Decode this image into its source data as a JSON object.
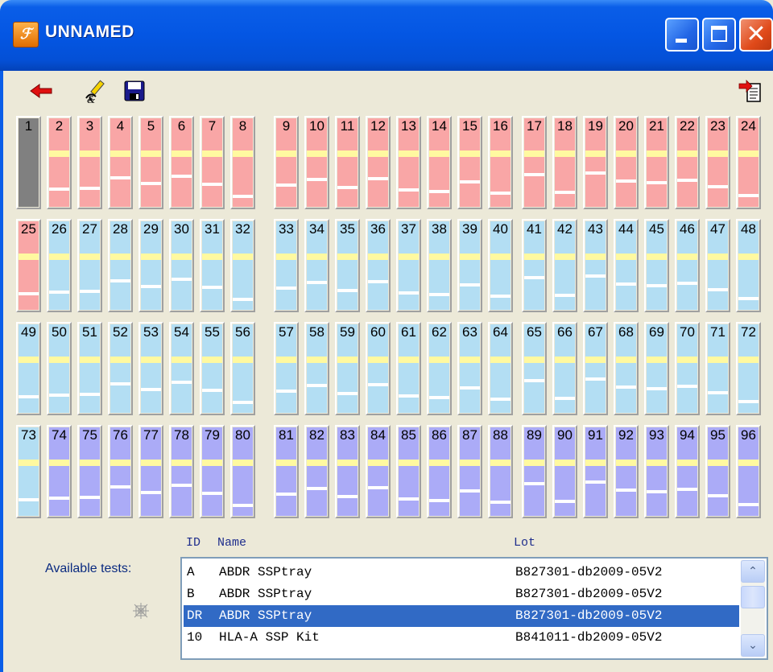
{
  "window": {
    "title": "UNNAMED",
    "accent": "#0a5ee8"
  },
  "toolbar": {
    "back_icon": "red-left-arrow-icon",
    "clear_icon": "eraser-pencil-icon",
    "save_icon": "floppy-disk-icon",
    "export_icon": "export-document-icon"
  },
  "colors": {
    "pink": "#f9a6a6",
    "blue": "#b3def3",
    "purple": "#ababf7",
    "selected_well": "#808080",
    "highlight": "#fff9a0"
  },
  "wells": [
    {
      "label": "1",
      "color": "#808080",
      "selected": true
    },
    {
      "label": "2",
      "color": "#f9a6a6"
    },
    {
      "label": "3",
      "color": "#f9a6a6"
    },
    {
      "label": "4",
      "color": "#f9a6a6"
    },
    {
      "label": "5",
      "color": "#f9a6a6"
    },
    {
      "label": "6",
      "color": "#f9a6a6"
    },
    {
      "label": "7",
      "color": "#f9a6a6"
    },
    {
      "label": "8",
      "color": "#f9a6a6"
    },
    {
      "label": "9",
      "color": "#f9a6a6"
    },
    {
      "label": "10",
      "color": "#f9a6a6"
    },
    {
      "label": "11",
      "color": "#f9a6a6"
    },
    {
      "label": "12",
      "color": "#f9a6a6"
    },
    {
      "label": "13",
      "color": "#f9a6a6"
    },
    {
      "label": "14",
      "color": "#f9a6a6"
    },
    {
      "label": "15",
      "color": "#f9a6a6"
    },
    {
      "label": "16",
      "color": "#f9a6a6"
    },
    {
      "label": "17",
      "color": "#f9a6a6"
    },
    {
      "label": "18",
      "color": "#f9a6a6"
    },
    {
      "label": "19",
      "color": "#f9a6a6"
    },
    {
      "label": "20",
      "color": "#f9a6a6"
    },
    {
      "label": "21",
      "color": "#f9a6a6"
    },
    {
      "label": "22",
      "color": "#f9a6a6"
    },
    {
      "label": "23",
      "color": "#f9a6a6"
    },
    {
      "label": "24",
      "color": "#f9a6a6"
    },
    {
      "label": "25",
      "color": "#f9a6a6"
    },
    {
      "label": "26",
      "color": "#b3def3"
    },
    {
      "label": "27",
      "color": "#b3def3"
    },
    {
      "label": "28",
      "color": "#b3def3"
    },
    {
      "label": "29",
      "color": "#b3def3"
    },
    {
      "label": "30",
      "color": "#b3def3"
    },
    {
      "label": "31",
      "color": "#b3def3"
    },
    {
      "label": "32",
      "color": "#b3def3"
    },
    {
      "label": "33",
      "color": "#b3def3"
    },
    {
      "label": "34",
      "color": "#b3def3"
    },
    {
      "label": "35",
      "color": "#b3def3"
    },
    {
      "label": "36",
      "color": "#b3def3"
    },
    {
      "label": "37",
      "color": "#b3def3"
    },
    {
      "label": "38",
      "color": "#b3def3"
    },
    {
      "label": "39",
      "color": "#b3def3"
    },
    {
      "label": "40",
      "color": "#b3def3"
    },
    {
      "label": "41",
      "color": "#b3def3"
    },
    {
      "label": "42",
      "color": "#b3def3"
    },
    {
      "label": "43",
      "color": "#b3def3"
    },
    {
      "label": "44",
      "color": "#b3def3"
    },
    {
      "label": "45",
      "color": "#b3def3"
    },
    {
      "label": "46",
      "color": "#b3def3"
    },
    {
      "label": "47",
      "color": "#b3def3"
    },
    {
      "label": "48",
      "color": "#b3def3"
    },
    {
      "label": "49",
      "color": "#b3def3"
    },
    {
      "label": "50",
      "color": "#b3def3"
    },
    {
      "label": "51",
      "color": "#b3def3"
    },
    {
      "label": "52",
      "color": "#b3def3"
    },
    {
      "label": "53",
      "color": "#b3def3"
    },
    {
      "label": "54",
      "color": "#b3def3"
    },
    {
      "label": "55",
      "color": "#b3def3"
    },
    {
      "label": "56",
      "color": "#b3def3"
    },
    {
      "label": "57",
      "color": "#b3def3"
    },
    {
      "label": "58",
      "color": "#b3def3"
    },
    {
      "label": "59",
      "color": "#b3def3"
    },
    {
      "label": "60",
      "color": "#b3def3"
    },
    {
      "label": "61",
      "color": "#b3def3"
    },
    {
      "label": "62",
      "color": "#b3def3"
    },
    {
      "label": "63",
      "color": "#b3def3"
    },
    {
      "label": "64",
      "color": "#b3def3"
    },
    {
      "label": "65",
      "color": "#b3def3"
    },
    {
      "label": "66",
      "color": "#b3def3"
    },
    {
      "label": "67",
      "color": "#b3def3"
    },
    {
      "label": "68",
      "color": "#b3def3"
    },
    {
      "label": "69",
      "color": "#b3def3"
    },
    {
      "label": "70",
      "color": "#b3def3"
    },
    {
      "label": "71",
      "color": "#b3def3"
    },
    {
      "label": "72",
      "color": "#b3def3"
    },
    {
      "label": "73",
      "color": "#b3def3"
    },
    {
      "label": "74",
      "color": "#ababf7"
    },
    {
      "label": "75",
      "color": "#ababf7"
    },
    {
      "label": "76",
      "color": "#ababf7"
    },
    {
      "label": "77",
      "color": "#ababf7"
    },
    {
      "label": "78",
      "color": "#ababf7"
    },
    {
      "label": "79",
      "color": "#ababf7"
    },
    {
      "label": "80",
      "color": "#ababf7"
    },
    {
      "label": "81",
      "color": "#ababf7"
    },
    {
      "label": "82",
      "color": "#ababf7"
    },
    {
      "label": "83",
      "color": "#ababf7"
    },
    {
      "label": "84",
      "color": "#ababf7"
    },
    {
      "label": "85",
      "color": "#ababf7"
    },
    {
      "label": "86",
      "color": "#ababf7"
    },
    {
      "label": "87",
      "color": "#ababf7"
    },
    {
      "label": "88",
      "color": "#ababf7"
    },
    {
      "label": "89",
      "color": "#ababf7"
    },
    {
      "label": "90",
      "color": "#ababf7"
    },
    {
      "label": "91",
      "color": "#ababf7"
    },
    {
      "label": "92",
      "color": "#ababf7"
    },
    {
      "label": "93",
      "color": "#ababf7"
    },
    {
      "label": "94",
      "color": "#ababf7"
    },
    {
      "label": "95",
      "color": "#ababf7"
    },
    {
      "label": "96",
      "color": "#ababf7"
    }
  ],
  "tests": {
    "label": "Available tests:",
    "icon": "spider-web-icon",
    "columns": {
      "id": "ID",
      "name": "Name",
      "lot": "Lot"
    },
    "rows": [
      {
        "id": "A",
        "name": "ABDR SSPtray",
        "lot": "B827301-db2009-05V2",
        "selected": false
      },
      {
        "id": "B",
        "name": "ABDR SSPtray",
        "lot": "B827301-db2009-05V2",
        "selected": false
      },
      {
        "id": "DR",
        "name": "ABDR SSPtray",
        "lot": "B827301-db2009-05V2",
        "selected": true
      },
      {
        "id": "10",
        "name": "HLA-A SSP Kit",
        "lot": "B841011-db2009-05V2",
        "selected": false
      }
    ],
    "scroll_up_icon": "scroll-up-arrow-icon",
    "scroll_down_icon": "scroll-down-arrow-icon"
  }
}
